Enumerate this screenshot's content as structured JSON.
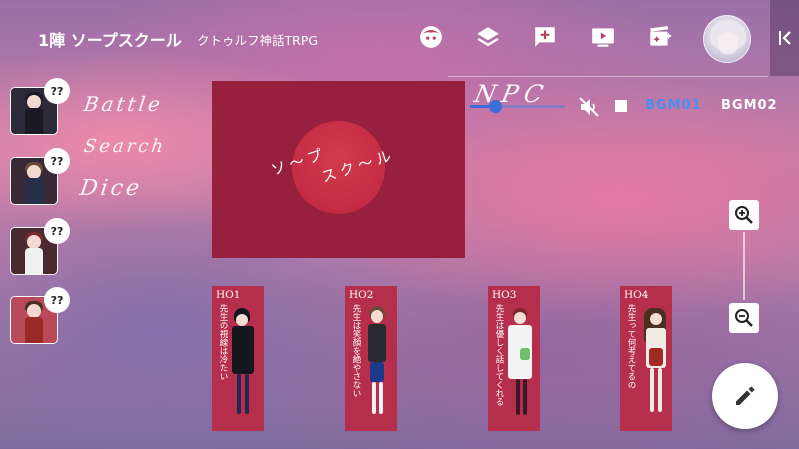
{
  "header": {
    "room_title": "1陣 ソープスクール",
    "room_subtitle": "クトゥルフ神話TRPG"
  },
  "toolbar": {
    "icons": [
      "character-face-icon",
      "layers-icon",
      "add-comment-icon",
      "play-screen-icon",
      "effects-icon",
      "user-avatar",
      "collapse-icon"
    ]
  },
  "characters": [
    {
      "badge": "??"
    },
    {
      "badge": "??"
    },
    {
      "badge": "??"
    },
    {
      "badge": "??"
    }
  ],
  "side_labels": {
    "battle": "Battle",
    "search": "Search",
    "dice": "Dice"
  },
  "board": {
    "line1": "ソ～プ",
    "line2": "スク～ル"
  },
  "audio": {
    "npc_label": "NPC",
    "volume": 0.25,
    "bgm1": "BGM01",
    "bgm2": "BGM02",
    "active_color": "#4a8ff0"
  },
  "ho_cards": [
    {
      "label": "HO1",
      "text": "先生の視線は冷たい"
    },
    {
      "label": "HO2",
      "text": "先生は笑顔を絶やさない"
    },
    {
      "label": "HO3",
      "text": "先生は優しく話してくれる"
    },
    {
      "label": "HO4",
      "text": "先生って何考えてるの"
    }
  ],
  "colors": {
    "board": "#97203e",
    "card": "#b52f4d",
    "accent": "#3b6fd8"
  }
}
